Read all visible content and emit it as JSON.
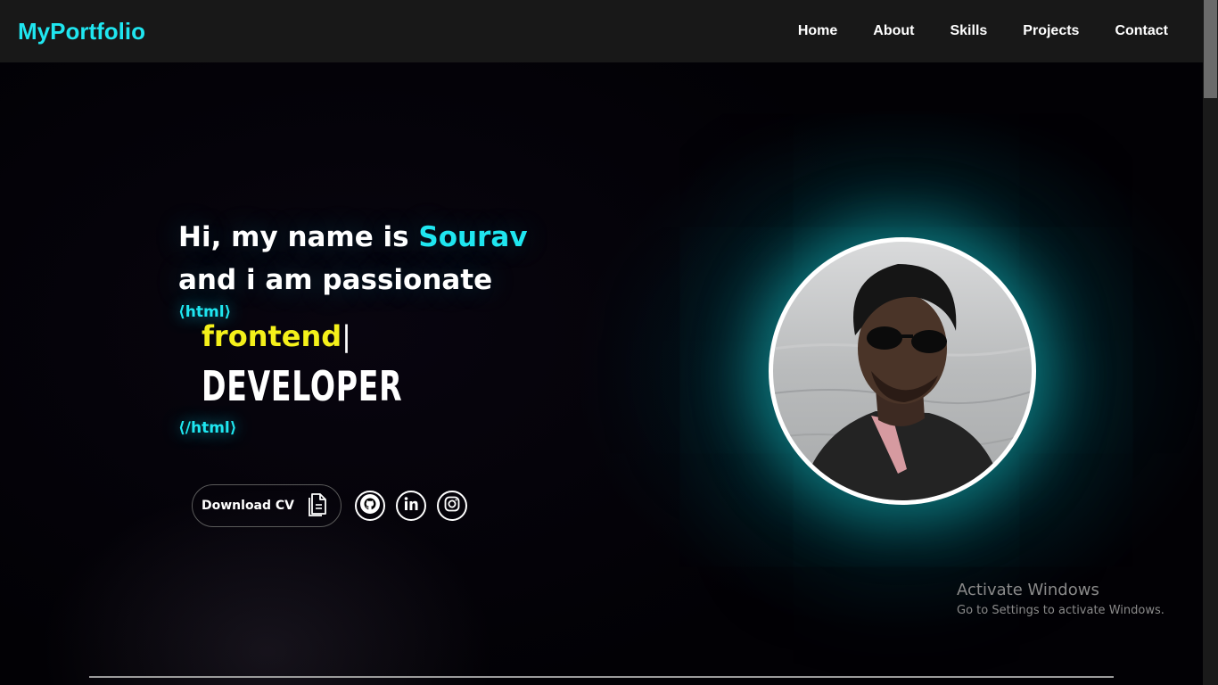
{
  "navbar": {
    "brand": "MyPortfolio",
    "links": [
      "Home",
      "About",
      "Skills",
      "Projects",
      "Contact"
    ]
  },
  "hero": {
    "greeting_prefix": "Hi, my name is ",
    "name": "Sourav",
    "greeting_line2": "and i am passionate",
    "tag_open": "⟨html⟩",
    "role": "frontend",
    "cursor": "|",
    "title": "DEVELOPER",
    "tag_close": "⟨/html⟩"
  },
  "actions": {
    "download_cv": "Download CV",
    "socials": [
      "github-icon",
      "linkedin-icon",
      "instagram-icon"
    ]
  },
  "watermark": {
    "title": "Activate Windows",
    "subtitle": "Go to Settings to activate Windows."
  },
  "colors": {
    "accent": "#1fe6f0",
    "role": "#f4f01a",
    "navbar_bg": "#181818"
  }
}
